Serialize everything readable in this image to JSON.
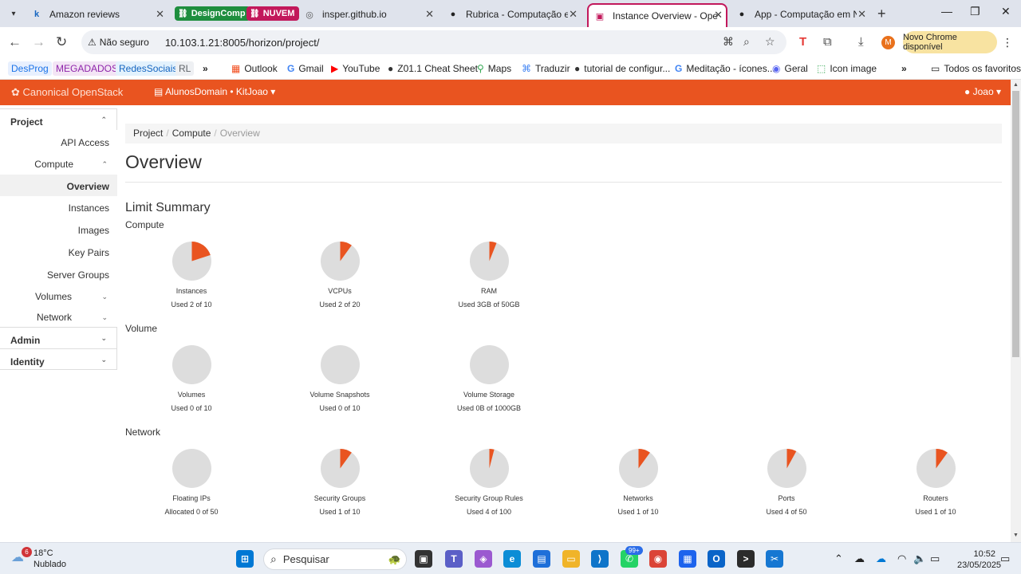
{
  "browser": {
    "tabs": [
      {
        "title": "Amazon reviews",
        "favicon": "k"
      },
      {
        "title": "DesignComp",
        "type": "group",
        "color": "#1e8e3e"
      },
      {
        "title": "NUVEM",
        "type": "group",
        "color": "#c2185b"
      },
      {
        "title": "insper.github.io",
        "favicon": "globe"
      },
      {
        "title": "Rubrica - Computação em N",
        "favicon": "github"
      },
      {
        "title": "Instance Overview - OpenSt",
        "favicon": "openstack",
        "active": true
      },
      {
        "title": "App - Computação em Nu",
        "favicon": "github"
      }
    ],
    "security_label": "Não seguro",
    "url": "10.103.1.21:8005/horizon/project/",
    "profile_initial": "M",
    "update_label": "Novo Chrome disponível",
    "bookmarks": [
      {
        "label": "DesProg",
        "color": "#1a73e8",
        "bg": "#e8f0fe"
      },
      {
        "label": "MEGADADOS",
        "color": "#8e24aa",
        "bg": "#f3e5f5"
      },
      {
        "label": "RedesSociais",
        "color": "#1565c0",
        "bg": "#e3f2fd"
      },
      {
        "label": "RL",
        "color": "#5f6368",
        "bg": "#eef0f3"
      },
      {
        "label": "Outlook"
      },
      {
        "label": "Gmail"
      },
      {
        "label": "YouTube"
      },
      {
        "label": "Z01.1 Cheat Sheet"
      },
      {
        "label": "Maps"
      },
      {
        "label": "Traduzir"
      },
      {
        "label": "tutorial de configur..."
      },
      {
        "label": "Meditação - ícones..."
      },
      {
        "label": "Geral"
      },
      {
        "label": "Icon image"
      }
    ],
    "all_bookmarks_label": "Todos os favoritos"
  },
  "header": {
    "brand": "Canonical OpenStack",
    "project_selector": "AlunosDomain • KitJoao",
    "user": "Joao",
    "accent": "#e95420"
  },
  "sidebar": {
    "sections": {
      "project": "Project",
      "admin": "Admin",
      "identity": "Identity"
    },
    "api_access": "API Access",
    "compute": "Compute",
    "compute_items": {
      "overview": "Overview",
      "instances": "Instances",
      "images": "Images",
      "key_pairs": "Key Pairs",
      "server_groups": "Server Groups"
    },
    "volumes": "Volumes",
    "network": "Network"
  },
  "breadcrumb": {
    "items": [
      "Project",
      "Compute"
    ],
    "current": "Overview"
  },
  "page_title": "Overview",
  "limit_summary": {
    "title": "Limit Summary",
    "compute_title": "Compute",
    "volume_title": "Volume",
    "network_title": "Network",
    "compute": [
      {
        "label": "Instances",
        "usage": "Used 2 of 10",
        "used": 2,
        "total": 10
      },
      {
        "label": "VCPUs",
        "usage": "Used 2 of 20",
        "used": 2,
        "total": 20
      },
      {
        "label": "RAM",
        "usage": "Used 3GB of 50GB",
        "used": 3,
        "total": 50
      }
    ],
    "volume": [
      {
        "label": "Volumes",
        "usage": "Used 0 of 10",
        "used": 0,
        "total": 10
      },
      {
        "label": "Volume Snapshots",
        "usage": "Used 0 of 10",
        "used": 0,
        "total": 10
      },
      {
        "label": "Volume Storage",
        "usage": "Used 0B of 1000GB",
        "used": 0,
        "total": 1000
      }
    ],
    "network": [
      {
        "label": "Floating IPs",
        "usage": "Allocated 0 of 50",
        "used": 0,
        "total": 50
      },
      {
        "label": "Security Groups",
        "usage": "Used 1 of 10",
        "used": 1,
        "total": 10
      },
      {
        "label": "Security Group Rules",
        "usage": "Used 4 of 100",
        "used": 4,
        "total": 100
      },
      {
        "label": "Networks",
        "usage": "Used 1 of 10",
        "used": 1,
        "total": 10
      },
      {
        "label": "Ports",
        "usage": "Used 4 of 50",
        "used": 4,
        "total": 50
      },
      {
        "label": "Routers",
        "usage": "Used 1 of 10",
        "used": 1,
        "total": 10
      }
    ],
    "pie_used_color": "#e95420",
    "pie_free_color": "#dddddd"
  },
  "taskbar": {
    "weather_temp": "18°C",
    "weather_desc": "Nublado",
    "weather_badge": "6",
    "search_placeholder": "Pesquisar",
    "whatsapp_badge": "99+",
    "time": "10:52",
    "date": "23/05/2025"
  }
}
